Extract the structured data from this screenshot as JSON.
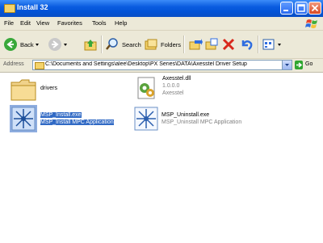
{
  "window": {
    "title": "Install 32",
    "icon": "folder-icon",
    "controls": [
      "minimize-icon",
      "maximize-icon",
      "close-icon"
    ]
  },
  "menu": [
    "File",
    "Edit",
    "View",
    "Favorites",
    "Tools",
    "Help"
  ],
  "toolbar": {
    "back_label": "Back",
    "search_label": "Search",
    "folders_label": "Folders"
  },
  "address": {
    "label": "Address",
    "path": "C:\\Documents and Settings\\alee\\Desktop\\PX Series\\DATA\\Axesstel Driver Setup",
    "go_label": "Go"
  },
  "files": [
    {
      "name": "drivers",
      "type": "folder",
      "icon": "folder-icon"
    },
    {
      "name": "Axesstel.dll",
      "version": "1.0.0.0",
      "company": "Axesstel",
      "icon": "dll-icon"
    },
    {
      "name": "MSP_Install.exe",
      "description": "MSP_Install MPC Application",
      "icon": "exe-icon",
      "selected": true
    },
    {
      "name": "MSP_Uninstall.exe",
      "description": "MSP_Uninstall MPC Application",
      "icon": "exe-icon",
      "selected": false
    }
  ],
  "colors": {
    "titlebar": "#0a5ce0",
    "selection": "#316ac5",
    "chrome": "#ece9d8"
  }
}
